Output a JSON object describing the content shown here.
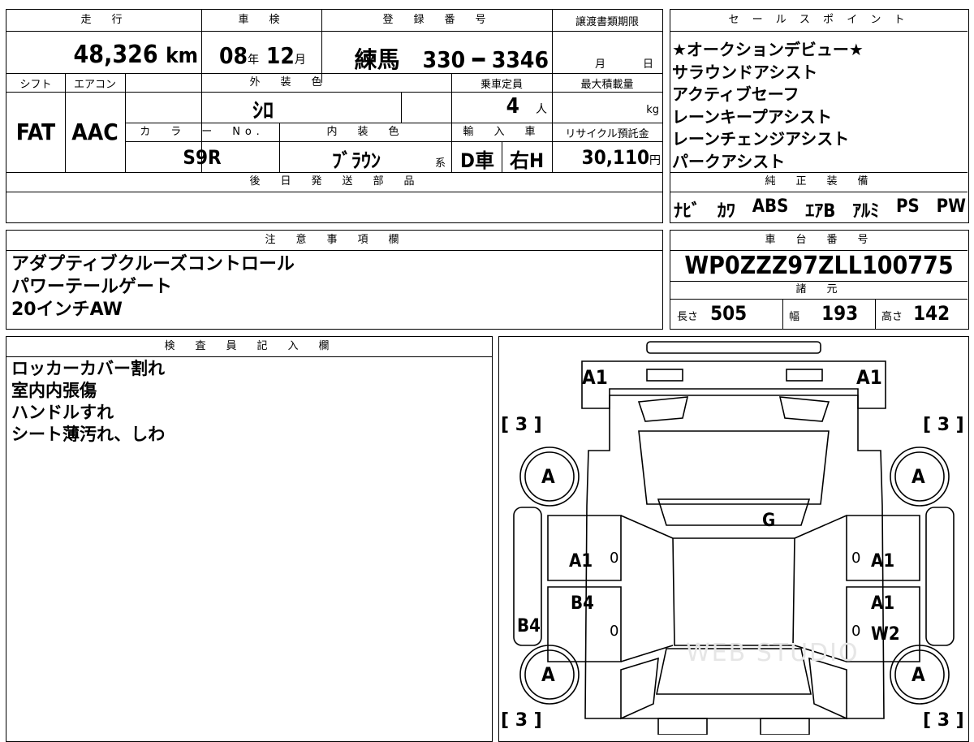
{
  "headers": {
    "mileage": "走　行",
    "inspection": "車　検",
    "registration": "登　録　番　号",
    "transfer_deadline": "譲渡書類期限",
    "shift": "シフト",
    "aircon": "エアコン",
    "exterior_color": "外　装　色",
    "capacity": "乗車定員",
    "max_load": "最大積載量",
    "color_no": "カ　ラ　ー　No.",
    "interior_color": "内　装　色",
    "import": "輸　入　車",
    "recycle_fee": "リサイクル預託金",
    "later_parts": "後　日　発　送　部　品",
    "sales_points": "セ ー ル ス ポ イ ン ト",
    "genuine_equipment": "純　正　装　備",
    "notes": "注　意　事　項　欄",
    "chassis_no": "車　台　番　号",
    "specs": "諸　元",
    "inspector": "検　査　員　記　入　欄"
  },
  "vehicle": {
    "mileage_value": "48,326",
    "mileage_unit": "km",
    "inspection_year": "08",
    "year_unit": "年",
    "inspection_month": "12",
    "month_unit": "月",
    "plate": "練馬　330 ━ 3346",
    "deadline_month_unit": "月",
    "deadline_day_unit": "日",
    "shift": "FAT",
    "aircon": "AAC",
    "exterior_color": "ｼﾛ",
    "capacity": "4",
    "capacity_unit": "人",
    "max_load_unit": "kg",
    "color_no": "S9R",
    "interior_color": "ﾌﾞﾗｳﾝ",
    "interior_suffix": "系",
    "import_type": "D車",
    "handle": "右H",
    "recycle_fee": "30,110",
    "recycle_unit": "円",
    "chassis_no": "WP0ZZZ97ZLL100775"
  },
  "sales_points": [
    "★オークションデビュー★",
    "サラウンドアシスト",
    "アクティブセーフ",
    "レーンキープアシスト",
    "レーンチェンジアシスト",
    "パークアシスト"
  ],
  "genuine_equipment": [
    "ﾅﾋﾞ",
    "ｶﾜ",
    "ABS",
    "ｴｱB",
    "ｱﾙﾐ",
    "PS",
    "PW"
  ],
  "notes": [
    "アダプティブクルーズコントロール",
    "パワーテールゲート",
    "20インチAW"
  ],
  "specs": {
    "length_label": "長さ",
    "length": "505",
    "width_label": "幅",
    "width": "193",
    "height_label": "高さ",
    "height": "142"
  },
  "inspector_notes": [
    "ロッカーカバー割れ",
    "室内内張傷",
    "ハンドルすれ",
    "シート薄汚れ、しわ"
  ],
  "diagram": {
    "front_left": "A1",
    "front_right": "A1",
    "bracket_tl": "[ 3 ]",
    "bracket_tr": "[ 3 ]",
    "bracket_bl": "[ 3 ]",
    "bracket_br": "[ 3 ]",
    "wheel_fl": "A",
    "wheel_fr": "A",
    "wheel_rl": "A",
    "wheel_rr": "A",
    "glass": "G",
    "door_fl": "A1",
    "door_fr": "A1",
    "door_rl": "B4",
    "door_rr_1": "A1",
    "door_rr_2": "W2",
    "rocker_l": "B4",
    "zero_fl": "0",
    "zero_fr": "0",
    "zero_rl": "0",
    "zero_rr": "0",
    "watermark": "WEB STUDIO"
  }
}
